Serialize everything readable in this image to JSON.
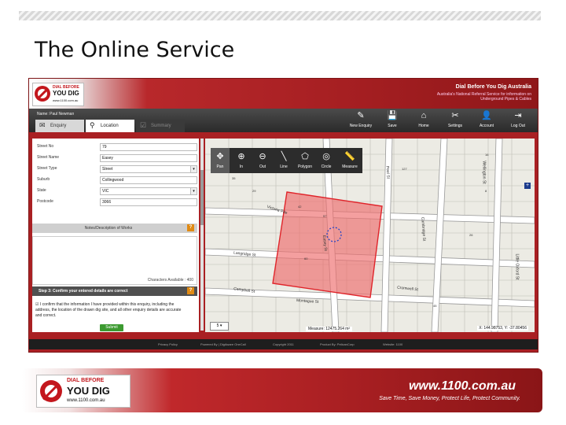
{
  "slide": {
    "title": "The Online Service"
  },
  "app": {
    "logo": {
      "line1": "DIAL BEFORE",
      "line2": "YOU DIG",
      "line3": "www.1100.com.au"
    },
    "title": "Dial Before You Dig Australia",
    "subtitle": "Australia's National Referral Service for information on Underground Pipes & Cables",
    "user": "Name: Paul Newman",
    "tabs": [
      {
        "label": "Enquiry",
        "icon": "✉"
      },
      {
        "label": "Location",
        "icon": "⚲"
      },
      {
        "label": "Summary",
        "icon": "☑"
      }
    ],
    "toolbar": [
      {
        "label": "New Enquiry",
        "icon": "✎"
      },
      {
        "label": "Save",
        "icon": "💾"
      },
      {
        "label": "Home",
        "icon": "⌂"
      },
      {
        "label": "Settings",
        "icon": "✂"
      },
      {
        "label": "Account",
        "icon": "👤"
      },
      {
        "label": "Log Out",
        "icon": "⇥"
      }
    ]
  },
  "form": {
    "fields": [
      {
        "label": "Street No",
        "value": "79"
      },
      {
        "label": "Street Name",
        "value": "Easey"
      },
      {
        "label": "Street Type",
        "value": "Street"
      },
      {
        "label": "Suburb",
        "value": "Collingwood"
      },
      {
        "label": "State",
        "value": "VIC"
      },
      {
        "label": "Postcode",
        "value": "3066"
      }
    ],
    "notes_title": "Notes/Description of Works",
    "help": "?",
    "chars_available": "Characters Available : 400",
    "step3_title": "Step 3: Confirm your entered details are correct",
    "confirm_text": "I confirm that the information I have provided within this enquiry, including the address, the location of the drawn dig site, and all other enquiry details are accurate and correct.",
    "submit_label": "Submit"
  },
  "map": {
    "tools": [
      {
        "label": "Pan",
        "icon": "✥"
      },
      {
        "label": "In",
        "icon": "⊕"
      },
      {
        "label": "Out",
        "icon": "⊖"
      },
      {
        "label": "Line",
        "icon": "╲"
      },
      {
        "label": "Polygon",
        "icon": "⬠"
      },
      {
        "label": "Circle",
        "icon": "◎"
      },
      {
        "label": "Measure",
        "icon": "📏"
      }
    ],
    "streets": [
      {
        "name": "Victoria Pde"
      },
      {
        "name": "Langridge St"
      },
      {
        "name": "Campbell St"
      },
      {
        "name": "Cromwell St"
      },
      {
        "name": "Easey St"
      },
      {
        "name": "Peel St"
      },
      {
        "name": "Montague St"
      },
      {
        "name": "Cambridge St"
      },
      {
        "name": "Wellington St"
      },
      {
        "name": "Little Oxford St"
      }
    ],
    "plus": "+",
    "scale": "5 ▾",
    "measure": "Measure: 12475.264 m²",
    "coords": "X: 144.98753, Y: -37.80456"
  },
  "footer": {
    "links": [
      "Privacy Policy",
      "Powered By | DigAware OneCall",
      "Copyright 2011",
      "Product By: PelicanCorp",
      "Website: 1100"
    ]
  },
  "banner": {
    "logo_line1": "DIAL BEFORE",
    "logo_line2": "YOU DIG",
    "logo_line3": "www.1100.com.au",
    "url": "www.1100.com.au",
    "tagline": "Save Time, Save Money, Protect Life, Protect Community."
  }
}
